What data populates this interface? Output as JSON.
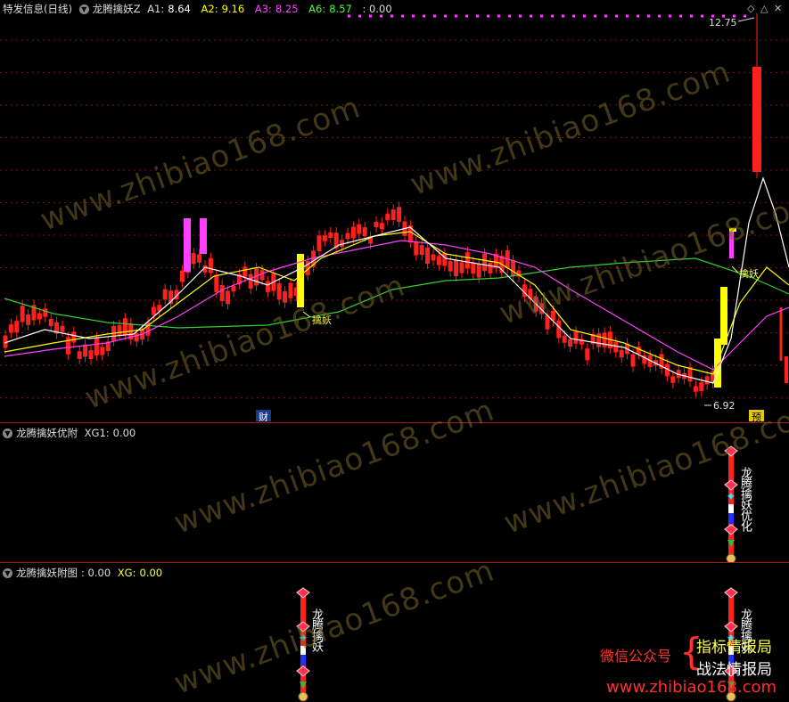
{
  "main": {
    "title": "特发信息(日线)",
    "indicator": "龙腾擒妖Z",
    "values": [
      {
        "label": "A1:",
        "value": "8.64",
        "color": "#ffffff"
      },
      {
        "label": "A2:",
        "value": "9.16",
        "color": "#ffff00"
      },
      {
        "label": "A3:",
        "value": "8.25",
        "color": "#ff40ff"
      },
      {
        "label": "A6:",
        "value": "8.57",
        "color": "#40ff40"
      }
    ],
    "trailing": ": 0.00",
    "high_label": "12.75",
    "low_label": "6.92",
    "signal_label_1": "擒妖",
    "signal_label_2": "擒妖",
    "badge_cai": "财",
    "badge_yu": "预"
  },
  "sub1": {
    "title": "龙腾擒妖优附",
    "xg_label": "XG1:",
    "xg_value": "0.00",
    "vertical_text": "龙腾擒妖优化"
  },
  "sub2": {
    "title": "龙腾擒妖附图",
    "value_label": ": 0.00",
    "xg_label": "XG:",
    "xg_value": "0.00",
    "vertical_text_1": "龙腾擒妖",
    "vertical_text_2": "龙腾擒妖"
  },
  "watermark": "www.zhibiao168.com",
  "promo": {
    "wechat": "微信公众号",
    "line1": "指标情报局",
    "line2": "战法情报局",
    "site": "www.zhibiao168.com"
  },
  "colors": {
    "up": "#ff2020",
    "yellow": "#ffff00",
    "magenta": "#ff40ff",
    "green": "#30d030",
    "white": "#ffffff"
  }
}
